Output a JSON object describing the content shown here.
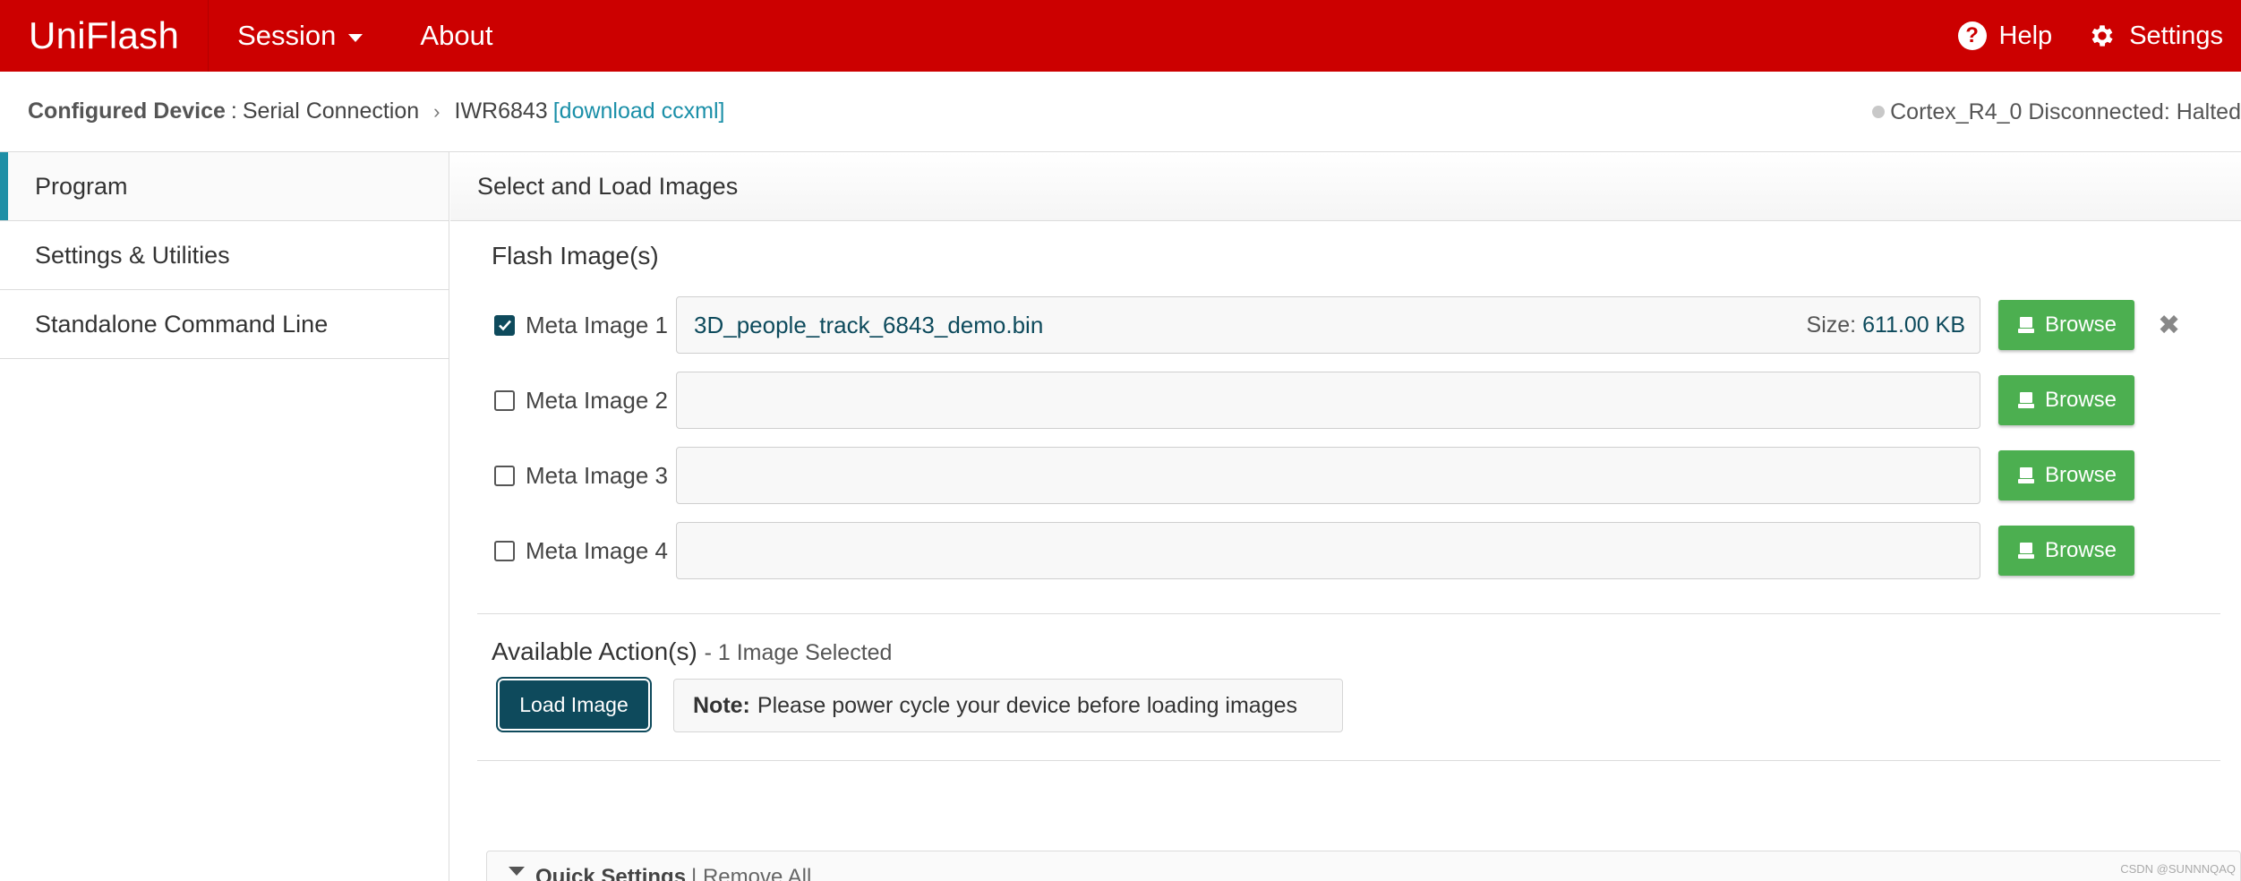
{
  "topbar": {
    "brand": "UniFlash",
    "menu_session": "Session",
    "menu_about": "About",
    "help_label": "Help",
    "settings_label": "Settings",
    "icons": [
      "help-icon",
      "gear-icon",
      "chevron-down-icon"
    ],
    "color": "#cc0000"
  },
  "breadcrumb": {
    "configured_label": "Configured Device",
    "separator": ":",
    "connection": "Serial Connection",
    "device": "IWR6843",
    "download_link": "[download ccxml]",
    "status": "Cortex_R4_0 Disconnected: Halted"
  },
  "sidebar": {
    "items": [
      {
        "label": "Program",
        "active": true
      },
      {
        "label": "Settings & Utilities",
        "active": false
      },
      {
        "label": "Standalone Command Line",
        "active": false
      }
    ]
  },
  "main": {
    "header": "Select and Load Images",
    "flash_title": "Flash Image(s)",
    "images": [
      {
        "label": "Meta Image 1",
        "checked": true,
        "file": "3D_people_track_6843_demo.bin",
        "size_label": "Size:",
        "size_value": "611.00 KB",
        "browse": "Browse"
      },
      {
        "label": "Meta Image 2",
        "checked": false,
        "file": "",
        "browse": "Browse"
      },
      {
        "label": "Meta Image 3",
        "checked": false,
        "file": "",
        "browse": "Browse"
      },
      {
        "label": "Meta Image 4",
        "checked": false,
        "file": "",
        "browse": "Browse"
      }
    ],
    "actions_title": "Available Action(s)",
    "actions_sub": "- 1 Image Selected",
    "load_button": "Load Image",
    "note_label": "Note:",
    "note_text": "Please power cycle your device before loading images",
    "quick_settings": "Quick Settings",
    "remove_all": "| Remove All"
  },
  "watermark": "CSDN @SUNNNQAQ",
  "colors": {
    "accent": "#1f8fa6",
    "primary_button": "#0e4a5c",
    "browse_green": "#4caf50"
  }
}
